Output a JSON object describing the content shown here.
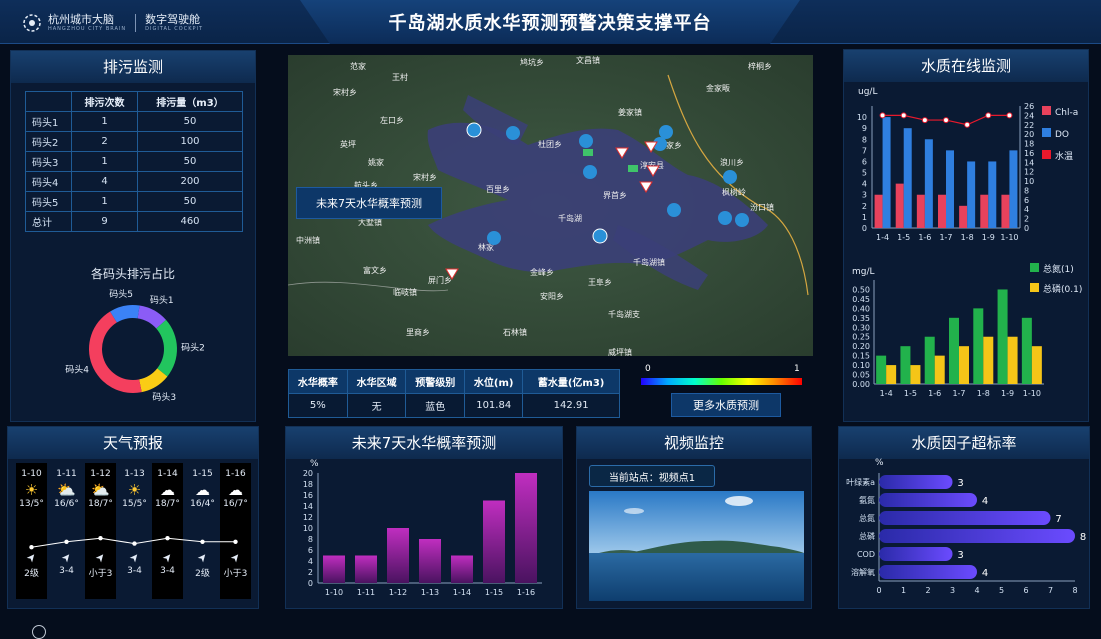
{
  "header": {
    "title": "千岛湖水质水华预测预警决策支撑平台",
    "logo_main": "杭州城市大脑",
    "logo_main_sub": "HANGZHOU CITY BRAIN",
    "logo_second": "数字驾驶舱",
    "logo_second_sub": "DIGITAL COCKPIT"
  },
  "discharge": {
    "title": "排污监测",
    "columns": [
      "",
      "排污次数",
      "排污量（m3）"
    ],
    "rows": [
      {
        "name": "码头1",
        "count": "1",
        "volume": "50"
      },
      {
        "name": "码头2",
        "count": "2",
        "volume": "100"
      },
      {
        "name": "码头3",
        "count": "1",
        "volume": "50"
      },
      {
        "name": "码头4",
        "count": "4",
        "volume": "200"
      },
      {
        "name": "码头5",
        "count": "1",
        "volume": "50"
      },
      {
        "name": "总计",
        "count": "9",
        "volume": "460"
      }
    ],
    "donut_title": "各码头排污占比",
    "donut": [
      {
        "label": "码头1",
        "value": 50,
        "color": "#8b5cf6"
      },
      {
        "label": "码头2",
        "value": 100,
        "color": "#22c55e"
      },
      {
        "label": "码头3",
        "value": 50,
        "color": "#facc15"
      },
      {
        "label": "码头4",
        "value": 200,
        "color": "#f43f5e"
      },
      {
        "label": "码头5",
        "value": 50,
        "color": "#3b82f6"
      }
    ]
  },
  "map": {
    "forecast_button": "未来7天水华概率预测",
    "more_button": "更多水质预测",
    "gradient_min": "0",
    "gradient_max": "1",
    "places": [
      "范家",
      "王村",
      "宋村乡",
      "左口乡",
      "英坪",
      "姚家",
      "航头乡",
      "宋村乡",
      "杜团乡",
      "千岛湖",
      "界首乡",
      "百里乡",
      "金峰乡",
      "姜家镇",
      "淳安县",
      "文昌镇",
      "鸠坑乡",
      "严家乡",
      "金家畈",
      "梓桐乡",
      "浪川乡",
      "枫树岭",
      "汾口镇",
      "中洲镇",
      "大墅镇",
      "富文乡",
      "临岐镇",
      "屏门乡",
      "安阳乡",
      "石林镇",
      "里商乡",
      "千岛湖镇",
      "威坪镇",
      "王阜乡",
      "林家",
      "千岛湖支"
    ]
  },
  "bloom_table": {
    "columns": [
      "水华概率",
      "水华区域",
      "预警级别",
      "水位(m)",
      "蓄水量(亿m3)"
    ],
    "values": [
      "5%",
      "无",
      "蓝色",
      "101.84",
      "142.91"
    ]
  },
  "quality": {
    "title": "水质在线监测",
    "unit_top": "ug/L",
    "legend_top": [
      "Chl-a",
      "DO",
      "水温"
    ],
    "legend_top_colors": [
      "#e8425c",
      "#2f7fe0",
      "#e8192c"
    ],
    "unit_bottom": "mg/L",
    "legend_bottom": [
      "总氮(1)",
      "总磷(0.1)"
    ],
    "legend_bottom_colors": [
      "#22b24c",
      "#f5c518"
    ]
  },
  "weather": {
    "title": "天气预报",
    "days": [
      {
        "date": "1-10",
        "icon": "sunny-icon",
        "temp": "13/5°",
        "wind": "2级",
        "dark": true
      },
      {
        "date": "1-11",
        "icon": "partly-cloudy-icon",
        "temp": "16/6°",
        "wind": "3-4",
        "dark": false
      },
      {
        "date": "1-12",
        "icon": "partly-cloudy-icon",
        "temp": "18/7°",
        "wind": "小于3",
        "dark": true
      },
      {
        "date": "1-13",
        "icon": "sunny-icon",
        "temp": "15/5°",
        "wind": "3-4",
        "dark": false
      },
      {
        "date": "1-14",
        "icon": "rain-icon",
        "temp": "18/7°",
        "wind": "3-4",
        "dark": true
      },
      {
        "date": "1-15",
        "icon": "rain-icon",
        "temp": "16/4°",
        "wind": "2级",
        "dark": false
      },
      {
        "date": "1-16",
        "icon": "rain-icon",
        "temp": "16/7°",
        "wind": "小于3",
        "dark": true
      }
    ]
  },
  "forecast": {
    "title": "未来7天水华概率预测",
    "unit": "%"
  },
  "video": {
    "title": "视频监控",
    "station": "当前站点：视频点1"
  },
  "exceed": {
    "title": "水质因子超标率",
    "unit": "%"
  },
  "chart_data": [
    {
      "type": "bar",
      "title": "",
      "categories": [
        "1-4",
        "1-5",
        "1-6",
        "1-7",
        "1-8",
        "1-9",
        "1-10"
      ],
      "series": [
        {
          "name": "Chl-a",
          "values": [
            3,
            4,
            3,
            3,
            2,
            3,
            3
          ],
          "axis": "left"
        },
        {
          "name": "DO",
          "values": [
            10,
            9,
            8,
            7,
            6,
            6,
            7
          ],
          "axis": "left"
        },
        {
          "name": "水温",
          "type": "line",
          "values": [
            24,
            24,
            23,
            23,
            22,
            24,
            24
          ],
          "axis": "right"
        }
      ],
      "ylabel": "ug/L",
      "ylim": [
        0,
        11
      ],
      "y2lim": [
        0,
        26
      ]
    },
    {
      "type": "bar",
      "title": "",
      "categories": [
        "1-4",
        "1-5",
        "1-6",
        "1-7",
        "1-8",
        "1-9",
        "1-10"
      ],
      "series": [
        {
          "name": "总氮(1)",
          "values": [
            0.15,
            0.2,
            0.25,
            0.35,
            0.4,
            0.5,
            0.35
          ]
        },
        {
          "name": "总磷(0.1)",
          "values": [
            0.1,
            0.1,
            0.15,
            0.2,
            0.25,
            0.25,
            0.2
          ]
        }
      ],
      "ylabel": "mg/L",
      "ylim": [
        0,
        0.55
      ]
    },
    {
      "type": "bar",
      "title": "",
      "categories": [
        "1-10",
        "1-11",
        "1-12",
        "1-13",
        "1-14",
        "1-15",
        "1-16"
      ],
      "values": [
        5,
        5,
        10,
        8,
        5,
        15,
        20
      ],
      "ylabel": "%",
      "ylim": [
        0,
        20
      ]
    },
    {
      "type": "bar",
      "orientation": "horizontal",
      "title": "",
      "categories": [
        "叶绿素a",
        "氨氮",
        "总氮",
        "总磷",
        "COD",
        "溶解氧"
      ],
      "values": [
        3,
        4,
        7,
        8,
        3,
        4
      ],
      "ylabel": "%",
      "xlim": [
        0,
        8
      ]
    },
    {
      "type": "pie",
      "title": "各码头排污占比",
      "categories": [
        "码头1",
        "码头2",
        "码头3",
        "码头4",
        "码头5"
      ],
      "values": [
        50,
        100,
        50,
        200,
        50
      ]
    },
    {
      "type": "line",
      "title": "",
      "categories": [
        "1-10",
        "1-11",
        "1-12",
        "1-13",
        "1-14",
        "1-15",
        "1-16"
      ],
      "values": [
        13,
        16,
        18,
        15,
        18,
        16,
        16
      ]
    }
  ]
}
